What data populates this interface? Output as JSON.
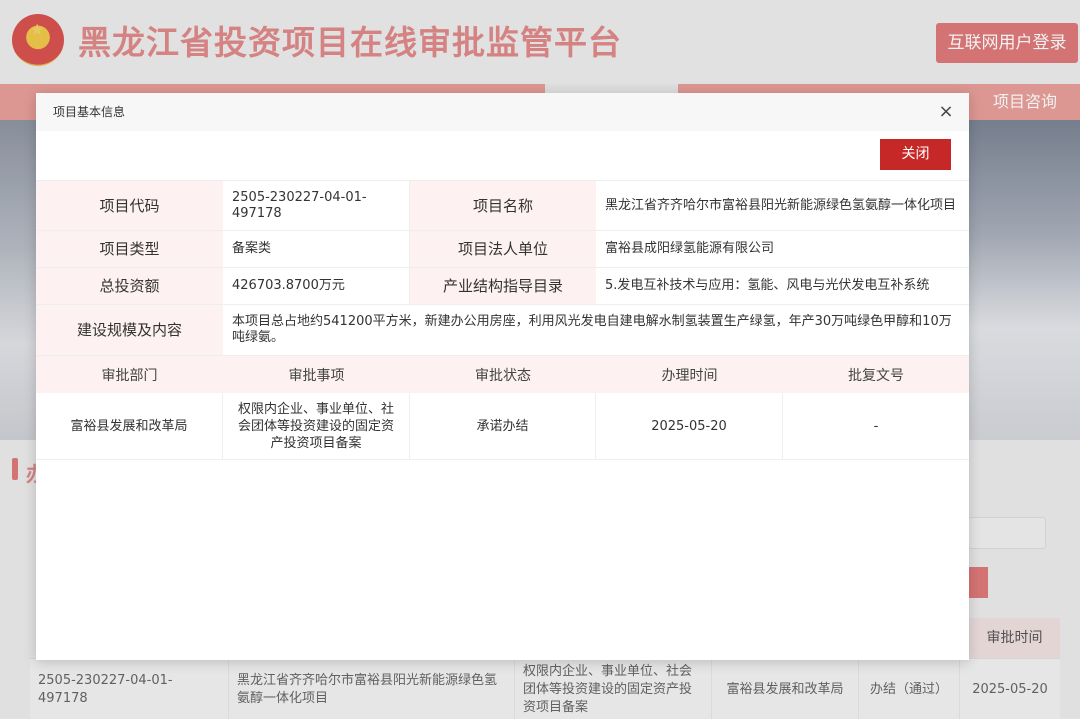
{
  "site": {
    "title": "黑龙江省投资项目在线审批监管平台",
    "login_label": "互联网用户登录",
    "nav_item": "项目咨询"
  },
  "background": {
    "section_glyph": "办",
    "table_header_time": "审批时间",
    "row": {
      "code": "2505-230227-04-01-497178",
      "name": "黑龙江省齐齐哈尔市富裕县阳光新能源绿色氢氨醇一体化项目",
      "matter": "权限内企业、事业单位、社会团体等投资建设的固定资产投资项目备案",
      "dept": "富裕县发展和改革局",
      "status": "办结（通过）",
      "date": "2025-05-20"
    }
  },
  "modal": {
    "title": "项目基本信息",
    "close_icon": "×",
    "close_button": "关闭",
    "info": {
      "code_label": "项目代码",
      "code": "2505-230227-04-01-497178",
      "name_label": "项目名称",
      "name": "黑龙江省齐齐哈尔市富裕县阳光新能源绿色氢氨醇一体化项目",
      "type_label": "项目类型",
      "type": "备案类",
      "legal_label": "项目法人单位",
      "legal": "富裕县成阳绿氢能源有限公司",
      "invest_label": "总投资额",
      "invest": "426703.8700万元",
      "industry_label": "产业结构指导目录",
      "industry": "5.发电互补技术与应用：氢能、风电与光伏发电互补系统",
      "scale_label": "建设规模及内容",
      "scale": "本项目总占地约541200平方米，新建办公用房座，利用风光发电自建电解水制氢装置生产绿氢，年产30万吨绿色甲醇和10万吨绿氨。"
    },
    "approval": {
      "headers": [
        "审批部门",
        "审批事项",
        "审批状态",
        "办理时间",
        "批复文号"
      ],
      "rows": [
        [
          "富裕县发展和改革局",
          "权限内企业、事业单位、社会团体等投资建设的固定资产投资项目备案",
          "承诺办结",
          "2025-05-20",
          "-"
        ]
      ]
    }
  },
  "colors": {
    "accent_red": "#c62828",
    "label_bg": "#fdf1f1",
    "brand_faded": "#e07a7a"
  }
}
